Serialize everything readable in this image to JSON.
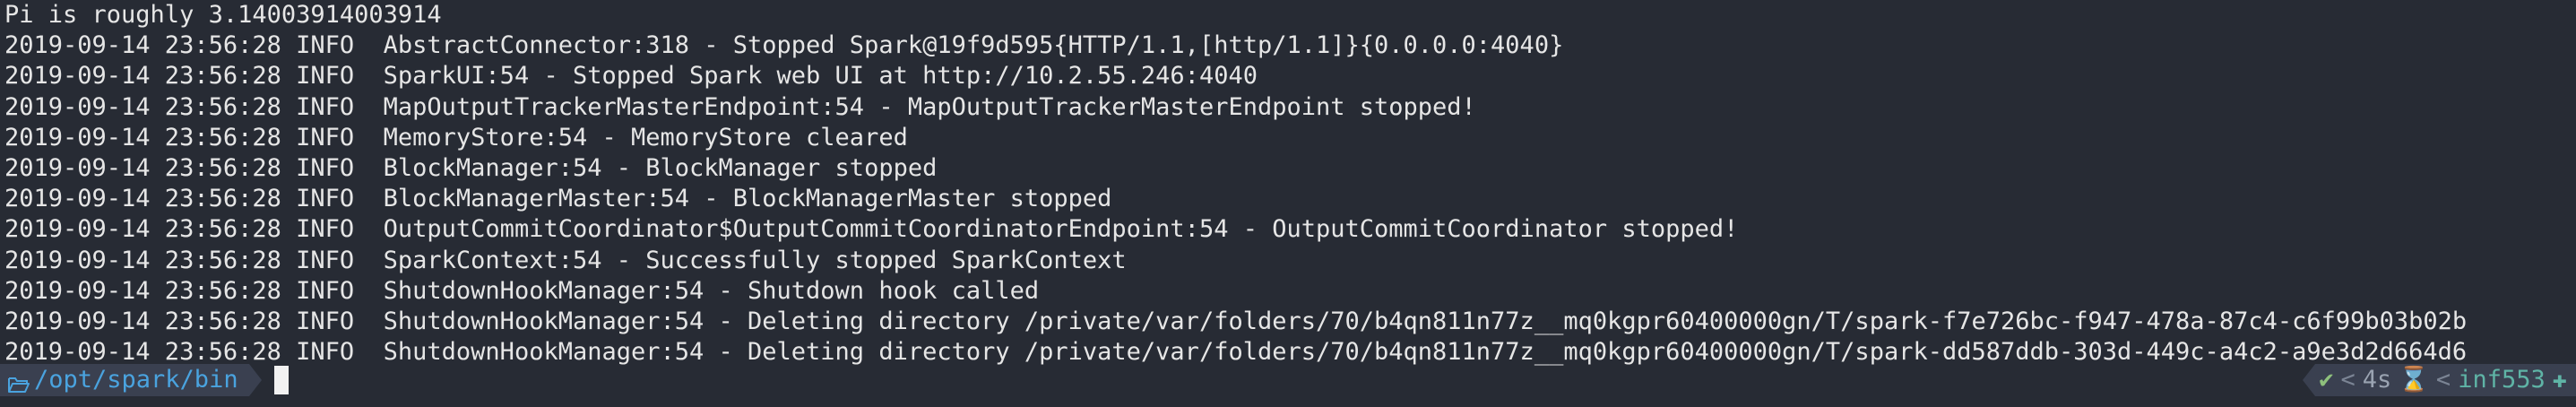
{
  "terminal": {
    "lines": [
      "Pi is roughly 3.14003914003914",
      "2019-09-14 23:56:28 INFO  AbstractConnector:318 - Stopped Spark@19f9d595{HTTP/1.1,[http/1.1]}{0.0.0.0:4040}",
      "2019-09-14 23:56:28 INFO  SparkUI:54 - Stopped Spark web UI at http://10.2.55.246:4040",
      "2019-09-14 23:56:28 INFO  MapOutputTrackerMasterEndpoint:54 - MapOutputTrackerMasterEndpoint stopped!",
      "2019-09-14 23:56:28 INFO  MemoryStore:54 - MemoryStore cleared",
      "2019-09-14 23:56:28 INFO  BlockManager:54 - BlockManager stopped",
      "2019-09-14 23:56:28 INFO  BlockManagerMaster:54 - BlockManagerMaster stopped",
      "2019-09-14 23:56:28 INFO  OutputCommitCoordinator$OutputCommitCoordinatorEndpoint:54 - OutputCommitCoordinator stopped!",
      "2019-09-14 23:56:28 INFO  SparkContext:54 - Successfully stopped SparkContext",
      "2019-09-14 23:56:28 INFO  ShutdownHookManager:54 - Shutdown hook called",
      "2019-09-14 23:56:28 INFO  ShutdownHookManager:54 - Deleting directory /private/var/folders/70/b4qn811n77z__mq0kgpr60400000gn/T/spark-f7e726bc-f947-478a-87c4-c6f99b03b02b",
      "2019-09-14 23:56:28 INFO  ShutdownHookManager:54 - Deleting directory /private/var/folders/70/b4qn811n77z__mq0kgpr60400000gn/T/spark-dd587ddb-303d-449c-a4c2-a9e3d2d664d6"
    ]
  },
  "prompt": {
    "path": "/opt/spark/bin",
    "folder_icon": "folder-open-icon",
    "cursor_icon": "block-cursor"
  },
  "right_prompt": {
    "status_icon": "checkmark-icon",
    "separator": "<",
    "duration": "4s",
    "hourglass_icon": "hourglass-icon",
    "hostname": "inf553",
    "extra_icon": "puzzle-icon"
  },
  "colors": {
    "background": "#272b34",
    "text": "#e6e6e6",
    "path": "#4aa3df",
    "segment_bg": "#3a4050",
    "success": "#8ec07c",
    "host": "#5fb4a6"
  }
}
